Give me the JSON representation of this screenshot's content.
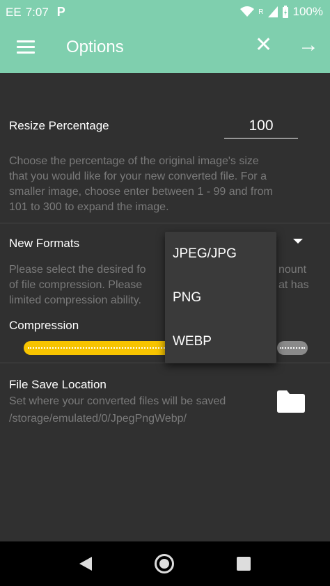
{
  "status": {
    "carrier": "EE",
    "time": "7:07",
    "notification_icon": "P",
    "roaming": "R",
    "battery": "100%"
  },
  "toolbar": {
    "title": "Options"
  },
  "resize": {
    "label": "Resize Percentage",
    "value": "100",
    "description_lines": [
      "Choose the percentage of the original image's size",
      "that you would like for your new converted file. For a",
      "smaller image, choose enter between 1 - 99 and from",
      "101 to 300 to expand the image."
    ]
  },
  "formats": {
    "label": "New Formats",
    "description_lines": [
      "Please select the desired fo",
      "of file compression. Please",
      "limited compression ability."
    ],
    "description_right": [
      "nount",
      "at has"
    ],
    "options": [
      "JPEG/JPG",
      "PNG",
      "WEBP"
    ]
  },
  "compression": {
    "label": "Compression",
    "fraction": 0.55
  },
  "save_location": {
    "label": "File Save Location",
    "description": "Set where your converted files will be saved",
    "path": "/storage/emulated/0/JpegPngWebp/"
  },
  "colors": {
    "header": "#7fcfae",
    "background": "#303030",
    "slider_fill": "#f7c400"
  }
}
